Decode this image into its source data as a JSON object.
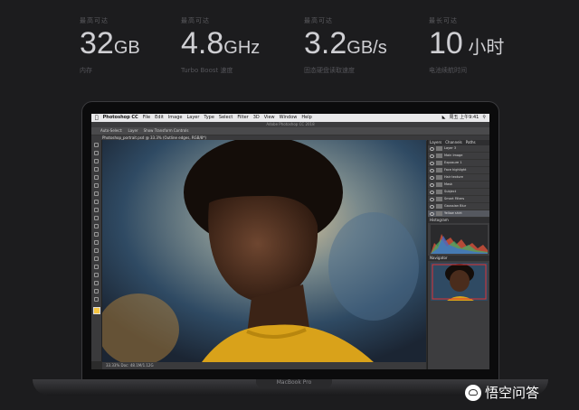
{
  "specs": [
    {
      "caption": "最高可达",
      "value": "32",
      "unit": "GB",
      "sub": "内存"
    },
    {
      "caption": "最高可达",
      "value": "4.8",
      "unit": "GHz",
      "sub": "Turbo Boost 速度"
    },
    {
      "caption": "最高可达",
      "value": "3.2",
      "unit": "GB/s",
      "sub": "固态硬盘读取速度"
    },
    {
      "caption": "最长可达",
      "value": "10",
      "unit": " 小时",
      "sub": "电池续航时间"
    }
  ],
  "menubar": {
    "app": "Photoshop CC",
    "items": [
      "File",
      "Edit",
      "Image",
      "Layer",
      "Type",
      "Select",
      "Filter",
      "3D",
      "View",
      "Window",
      "Help"
    ],
    "clock": "周五 上午9:41"
  },
  "window_title": "Adobe Photoshop CC 2018",
  "options_bar": {
    "auto_select": "Auto-Select:",
    "layer": "Layer",
    "transform": "Show Transform Controls"
  },
  "doc_tab": "Photoshop_portrait.psd @ 33.3% (Outline edges, RGB/8*)",
  "status_bar": "33.33%   Doc: 48.1M/1.12G",
  "panel_tabs": [
    "Layers",
    "Channels",
    "Paths"
  ],
  "layers": [
    "Layer 3",
    "Main Image",
    "Exposure 1",
    "Face highlight",
    "Hair texture",
    "Mask",
    "Subject",
    "Smart Filters",
    "Gaussian Blur",
    "Yellow shirt"
  ],
  "histogram_label": "Histogram",
  "navigator_label": "Navigator",
  "laptop_label": "MacBook Pro",
  "brand": "悟空问答",
  "icons": {
    "apple": "apple-icon",
    "brand": "wukong-logo-icon"
  }
}
